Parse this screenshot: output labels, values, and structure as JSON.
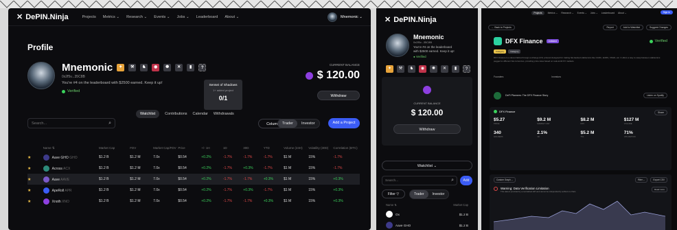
{
  "app": {
    "brand": "DePIN.Ninja"
  },
  "nav": {
    "items": [
      "Projects",
      "Metrics ⌄",
      "Research ⌄",
      "Events ⌄",
      "Jobs ⌄",
      "Leaderboard",
      "About ⌄"
    ],
    "user": "Mnemonic ⌄"
  },
  "profile": {
    "page_title": "Profile",
    "name": "Mnemonic",
    "address": "0x2f5v...35C8B",
    "rank_text": "You're #4 on the leaderboard with $2500 earned. Keep it up!",
    "verified": "Verified",
    "tooltip": {
      "title": "Sensei of Shadows",
      "subtitle": "1+ added project",
      "progress": "0/1"
    },
    "balance_label": "CURRENT BALANCE",
    "balance": "$ 120.00",
    "withdraw": "Withdraw"
  },
  "tabs": [
    "Watchlist",
    "Contributions",
    "Calendar",
    "Withdrawals"
  ],
  "controls": {
    "search_placeholder": "Search...",
    "columns": "Columns ⌄",
    "trader": "Trader",
    "investor": "Investor",
    "add_project": "Add a Project"
  },
  "table": {
    "headers": [
      "Name ⇅",
      "Market Cap",
      "FDV",
      "Market Cap/FDV",
      "Price",
      "+/- 1H",
      "1D",
      "30D",
      "YTD",
      "Volume (24H)",
      "Volatility (30D)",
      "Correlation (BTC)"
    ],
    "rows": [
      {
        "name": "Aave GHO",
        "ticker": "GHO",
        "color": "#3d3a8a",
        "cells": [
          "$1.2 B",
          "$1.2 M",
          "7.0x",
          "$0.54",
          "+0.2%",
          "-1.7%",
          "-1.7%",
          "-1.7%",
          "$1 M",
          "15%",
          "-1.7%"
        ]
      },
      {
        "name": "Across",
        "ticker": "ACX",
        "color": "#2d8a7a",
        "cells": [
          "$1.2 B",
          "$1.2 M",
          "7.0x",
          "$0.54",
          "+0.2%",
          "-1.7%",
          "+0.3%",
          "-1.7%",
          "$1 M",
          "15%",
          "-1.7%"
        ]
      },
      {
        "name": "Aave",
        "ticker": "AAVE",
        "color": "#7b59c9",
        "cells": [
          "$1.2 B",
          "$1.2 M",
          "7.0x",
          "$0.54",
          "+0.2%",
          "-1.7%",
          "-1.7%",
          "+0.3%",
          "$1 M",
          "15%",
          "+0.3%"
        ]
      },
      {
        "name": "ApeRoll",
        "ticker": "APR",
        "color": "#3b5cf5",
        "cells": [
          "$1.2 B",
          "$1.2 M",
          "7.0x",
          "$0.54",
          "+0.2%",
          "-1.7%",
          "+0.3%",
          "-1.7%",
          "$1 M",
          "15%",
          "+0.3%"
        ]
      },
      {
        "name": "Xnoth",
        "ticker": "XNO",
        "color": "#8d3fe0",
        "cells": [
          "$1.2 B",
          "$1.2 M",
          "7.0x",
          "$0.54",
          "+0.2%",
          "-1.7%",
          "-1.7%",
          "+0.3%",
          "$1 M",
          "15%",
          "+0.3%"
        ]
      }
    ]
  },
  "mobile": {
    "watchlist_select": "Watchlist ⌄",
    "add": "Add",
    "filter": "Filter",
    "col_name": "Name ⇅",
    "col_cap": "Market Cap",
    "rows": [
      {
        "name": "Ox",
        "value": "$1.2 B",
        "color": "#ffffff"
      },
      {
        "name": "Aave GHO",
        "value": "$1.2 B",
        "color": "#3d3a8a"
      },
      {
        "name": "Across",
        "value": "$1.2 B",
        "color": "#2d8a7a"
      }
    ]
  },
  "project": {
    "nav": [
      "Projects",
      "Metrics ⌄",
      "Research ⌄",
      "Events ⌄",
      "Jobs ⌄",
      "Leaderboard",
      "About ⌄"
    ],
    "signin": "Sign in",
    "back": "← Back to Projects",
    "report": "Report",
    "add_watchlist": "Add to Watchlist",
    "suggest": "Suggest Changes",
    "name": "DFX Finance",
    "tag": "Unlisted",
    "verified": "Verified",
    "chips": [
      "Category",
      "Category"
    ],
    "description": "DFX Finance is a decentralized foreign exchange (FX) protocol designed for trading fiat-backed stablecoins like CADC, EURS, XSGD, etc. It offers a way to swap between stablecoins pegged to different fiat currencies, providing price rates based on real-world FX markets.",
    "labels": [
      "Founders",
      "Investors"
    ],
    "podcast_title": "DeFi Planners: The DFX Finance Story",
    "podcast_button": "Listen on Spotify",
    "stats_title": "DFX Finance",
    "share": "Share",
    "stats": [
      {
        "v": "$5.27",
        "s": "PRICE"
      },
      {
        "v": "$9.2 M",
        "s": "MARKET CAP"
      },
      {
        "v": "$8.2 M",
        "s": "FDV"
      },
      {
        "v": "$127 M",
        "s": "VOLUME"
      },
      {
        "v": "340",
        "s": "HOLDERS"
      },
      {
        "v": "2.1%",
        "s": "1D"
      },
      {
        "v": "$5.2 M",
        "s": "TVL"
      },
      {
        "v": "71%",
        "s": "UTILIZATION"
      }
    ],
    "chart_controls": [
      "Custom Graph ⌄",
      "Filter ⌄",
      "Export CSV"
    ],
    "warning_title": "Warning: Data Verification Limitation",
    "warning_text": "This data is provided by a centralized API and cannot be independently verified on-chain.",
    "read_more": "Read more"
  },
  "colors": {
    "accent": "#3b5cf5",
    "positive": "#3bd35c",
    "negative": "#e04848",
    "balance_icon": "#8d3fe0"
  }
}
